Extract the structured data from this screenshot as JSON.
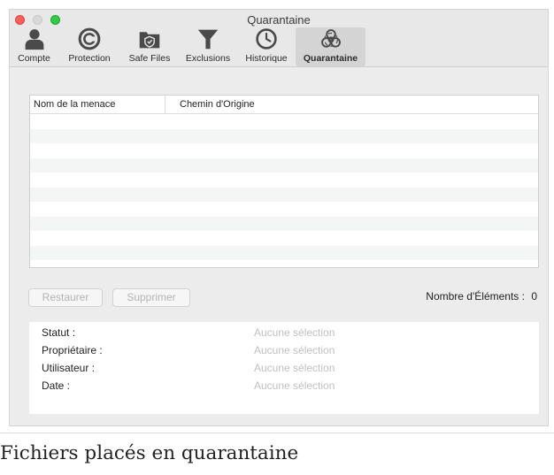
{
  "window": {
    "title": "Quarantaine"
  },
  "toolbar": {
    "items": [
      {
        "label": "Compte",
        "icon": "user-icon"
      },
      {
        "label": "Protection",
        "icon": "protection-icon"
      },
      {
        "label": "Safe Files",
        "icon": "safe-files-folder-icon"
      },
      {
        "label": "Exclusions",
        "icon": "funnel-icon"
      },
      {
        "label": "Historique",
        "icon": "clock-icon"
      },
      {
        "label": "Quarantaine",
        "icon": "biohazard-icon",
        "active": true
      }
    ]
  },
  "table": {
    "columns": [
      "Nom de la menace",
      "Chemin d'Origine"
    ],
    "rows": []
  },
  "actions": {
    "restore_label": "Restaurer",
    "delete_label": "Supprimer",
    "count_label": "Nombre d'Éléments :",
    "count_value": "0"
  },
  "details": {
    "status_label": "Statut :",
    "status_value": "Aucune sélection",
    "owner_label": "Propriétaire :",
    "owner_value": "Aucune sélection",
    "user_label": "Utilisateur :",
    "user_value": "Aucune sélection",
    "date_label": "Date :",
    "date_value": "Aucune sélection"
  },
  "caption": "Fichiers placés en quarantaine",
  "colors": {
    "close": "#fc605c",
    "maximize": "#34c84a",
    "icon": "#4a4a4a"
  }
}
